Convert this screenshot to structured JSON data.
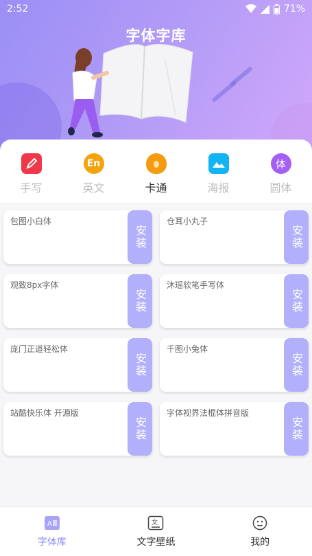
{
  "status_bar": {
    "time": "2:52",
    "battery": "71%"
  },
  "app_title": "字体字库",
  "categories": [
    {
      "label": "手写",
      "icon": "pen-icon",
      "glyph": "",
      "color": "#f0384a",
      "active": false
    },
    {
      "label": "英文",
      "icon": "en-icon",
      "glyph": "En",
      "color": "#f5a30d",
      "active": false
    },
    {
      "label": "卡通",
      "icon": "cartoon-icon",
      "glyph": "",
      "color": "#f39c12",
      "active": true
    },
    {
      "label": "海报",
      "icon": "poster-icon",
      "glyph": "",
      "color": "#12b4f4",
      "active": false
    },
    {
      "label": "圆体",
      "icon": "round-font-icon",
      "glyph": "体",
      "color": "#a65ff4",
      "active": false
    }
  ],
  "install_label": "安装",
  "fonts": [
    {
      "name": "包图小白体"
    },
    {
      "name": "仓耳小丸子"
    },
    {
      "name": "观致8px字体"
    },
    {
      "name": "沐瑶软笔手写体"
    },
    {
      "name": "庞门正道轻松体"
    },
    {
      "name": "千图小兔体"
    },
    {
      "name": "站酷快乐体 开源版"
    },
    {
      "name": "字体视界法棍体拼音版"
    }
  ],
  "bottom_nav": [
    {
      "label": "字体库",
      "icon": "font-library-icon",
      "active": true
    },
    {
      "label": "文字壁纸",
      "icon": "wallpaper-icon",
      "active": false
    },
    {
      "label": "我的",
      "icon": "profile-icon",
      "active": false
    }
  ],
  "colors": {
    "accent": "#8a86f3",
    "install_button": "#b3b0fb"
  }
}
